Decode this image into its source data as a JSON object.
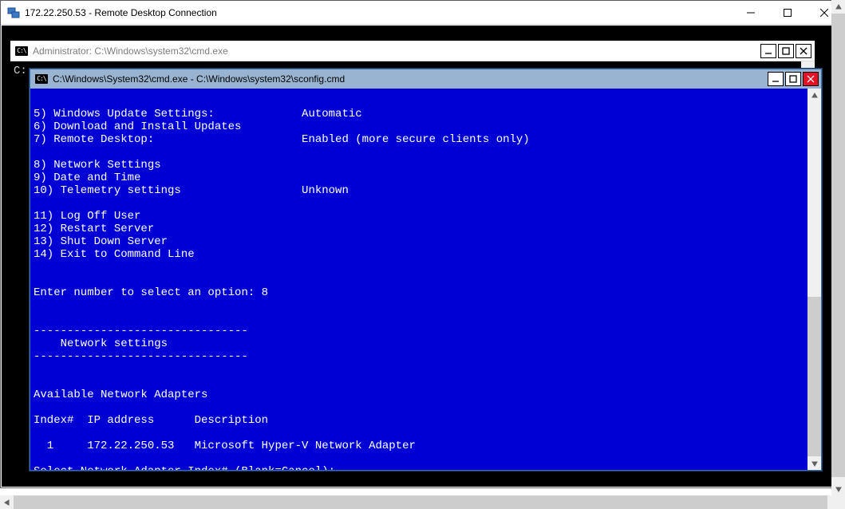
{
  "rdc": {
    "title": "172.22.250.53 - Remote Desktop Connection"
  },
  "admin_cmd": {
    "title": "Administrator: C:\\Windows\\system32\\cmd.exe",
    "prompt_fragment": "C:"
  },
  "sconfig": {
    "title": "C:\\Windows\\System32\\cmd.exe - C:\\Windows\\system32\\sconfig.cmd",
    "lines": [
      "",
      "5) Windows Update Settings:             Automatic",
      "6) Download and Install Updates",
      "7) Remote Desktop:                      Enabled (more secure clients only)",
      "",
      "8) Network Settings",
      "9) Date and Time",
      "10) Telemetry settings                  Unknown",
      "",
      "11) Log Off User",
      "12) Restart Server",
      "13) Shut Down Server",
      "14) Exit to Command Line",
      "",
      "",
      "Enter number to select an option: 8",
      "",
      "",
      "--------------------------------",
      "    Network settings",
      "--------------------------------",
      "",
      "",
      "Available Network Adapters",
      "",
      "Index#  IP address      Description",
      "",
      "  1     172.22.250.53   Microsoft Hyper-V Network Adapter",
      "",
      "Select Network Adapter Index# (Blank=Cancel): "
    ]
  }
}
